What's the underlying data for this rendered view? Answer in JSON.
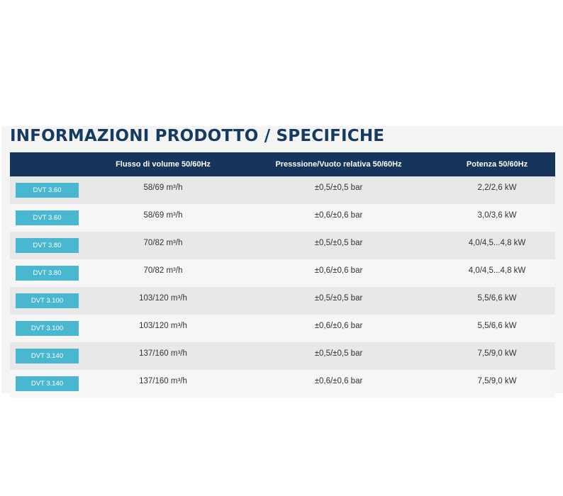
{
  "title": "INFORMAZIONI PRODOTTO / SPECIFICHE",
  "columns": {
    "model": "",
    "flow": "Flusso di volume 50/60Hz",
    "pressure": "Presssione/Vuoto relativa 50/60Hz",
    "power": "Potenza 50/60Hz"
  },
  "rows": [
    {
      "model": "DVT 3.60",
      "flow": "58/69 m³/h",
      "pressure": "±0,5/±0,5 bar",
      "power": "2,2/2,6 kW"
    },
    {
      "model": "DVT 3.60",
      "flow": "58/69 m³/h",
      "pressure": "±0,6/±0,6 bar",
      "power": "3,0/3,6 kW"
    },
    {
      "model": "DVT 3.80",
      "flow": "70/82 m³/h",
      "pressure": "±0,5/±0,5 bar",
      "power": "4,0/4,5...4,8 kW"
    },
    {
      "model": "DVT 3.80",
      "flow": "70/82 m³/h",
      "pressure": "±0,6/±0,6 bar",
      "power": "4,0/4,5...4,8 kW"
    },
    {
      "model": "DVT 3.100",
      "flow": "103/120 m³/h",
      "pressure": "±0,5/±0,5 bar",
      "power": "5,5/6,6 kW"
    },
    {
      "model": "DVT 3.100",
      "flow": "103/120 m³/h",
      "pressure": "±0,6/±0,6 bar",
      "power": "5,5/6,6 kW"
    },
    {
      "model": "DVT 3.140",
      "flow": "137/160 m³/h",
      "pressure": "±0,5/±0,5 bar",
      "power": "7,5/9,0 kW"
    },
    {
      "model": "DVT 3.140",
      "flow": "137/160 m³/h",
      "pressure": "±0,6/±0,6 bar",
      "power": "7,5/9,0 kW"
    }
  ],
  "colors": {
    "header": "#15355d",
    "title": "#163b63",
    "tag": "#4ab7d0"
  }
}
